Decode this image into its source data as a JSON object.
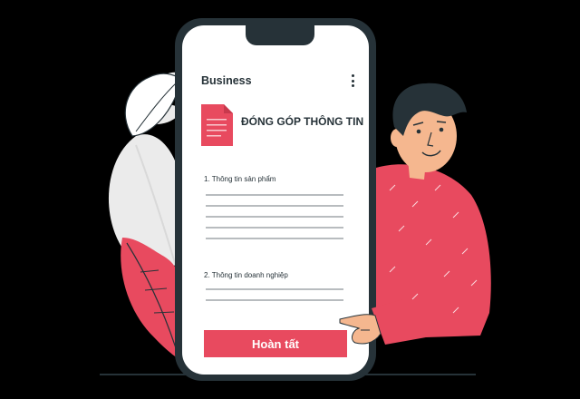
{
  "app": {
    "title": "Business",
    "menu_icon": "kebab-menu-icon"
  },
  "form": {
    "icon": "document-icon",
    "heading": "ĐÓNG GÓP THÔNG TIN",
    "section1_label": "1. Thông tin sản phẩm",
    "section2_label": "2. Thông tin doanh nghiệp",
    "submit_label": "Hoàn tất"
  },
  "colors": {
    "accent": "#e84a5f",
    "dark": "#263238",
    "leaf_gray": "#ebebeb",
    "skin": "#f5b78f"
  }
}
